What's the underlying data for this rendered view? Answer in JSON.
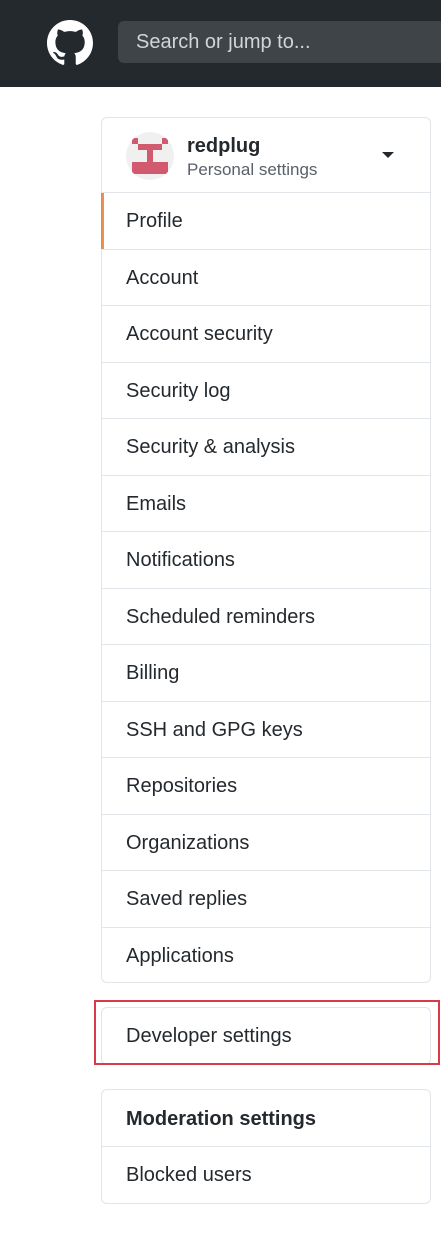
{
  "header": {
    "search_placeholder": "Search or jump to..."
  },
  "settings_menu": {
    "username": "redplug",
    "subtitle": "Personal settings",
    "items": [
      {
        "label": "Profile",
        "selected": true
      },
      {
        "label": "Account"
      },
      {
        "label": "Account security"
      },
      {
        "label": "Security log"
      },
      {
        "label": "Security & analysis"
      },
      {
        "label": "Emails"
      },
      {
        "label": "Notifications"
      },
      {
        "label": "Scheduled reminders"
      },
      {
        "label": "Billing"
      },
      {
        "label": "SSH and GPG keys"
      },
      {
        "label": "Repositories"
      },
      {
        "label": "Organizations"
      },
      {
        "label": "Saved replies"
      },
      {
        "label": "Applications"
      }
    ]
  },
  "developer": {
    "label": "Developer settings"
  },
  "moderation": {
    "heading": "Moderation settings",
    "items": [
      {
        "label": "Blocked users"
      }
    ]
  },
  "colors": {
    "topbar": "#24292e",
    "selected_accent": "#e36209",
    "highlight_border": "#d73a49"
  }
}
